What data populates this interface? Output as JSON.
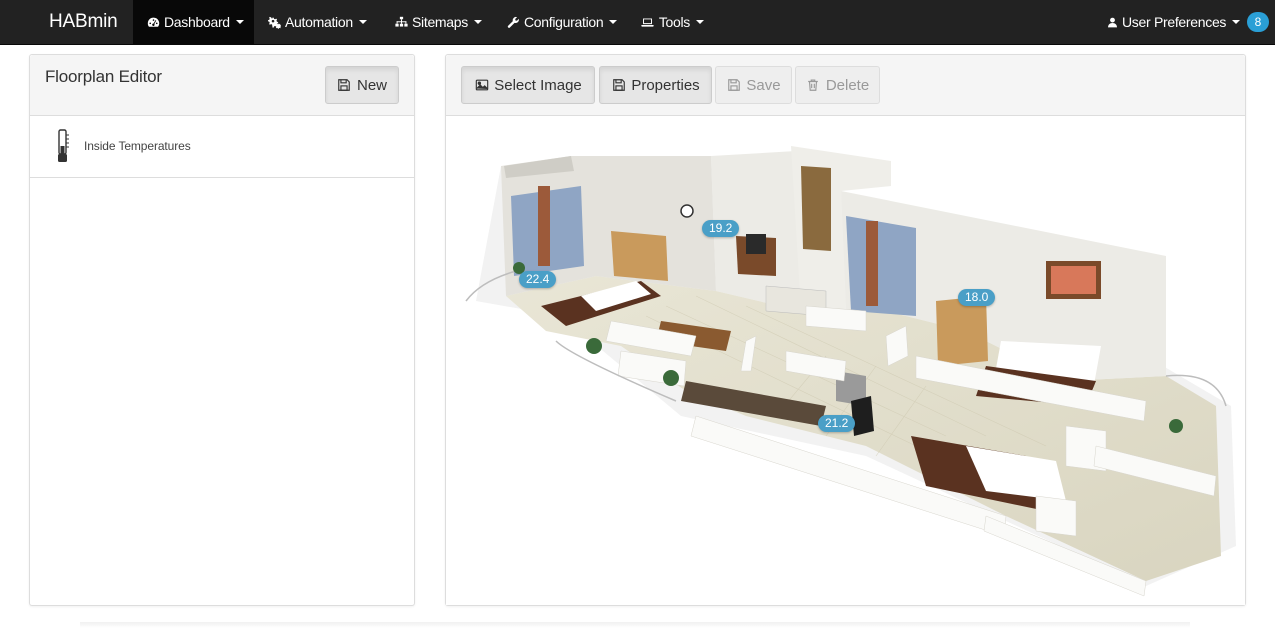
{
  "navbar": {
    "brand": "HABmin",
    "items": [
      {
        "label": "Dashboard",
        "icon": "dashboard-icon"
      },
      {
        "label": "Automation",
        "icon": "cogs-icon"
      },
      {
        "label": "Sitemaps",
        "icon": "sitemap-icon"
      },
      {
        "label": "Configuration",
        "icon": "wrench-icon"
      },
      {
        "label": "Tools",
        "icon": "laptop-icon"
      }
    ],
    "user_preferences": "User Preferences",
    "notification_count": "8"
  },
  "left_panel": {
    "title": "Floorplan Editor",
    "new_button": "New",
    "items": [
      {
        "label": "Inside Temperatures",
        "icon": "thermometer-icon"
      }
    ]
  },
  "toolbar": {
    "select_image": "Select Image",
    "properties": "Properties",
    "save": "Save",
    "delete": "Delete"
  },
  "floorplan": {
    "temperatures": [
      {
        "value": "19.2"
      },
      {
        "value": "22.4"
      },
      {
        "value": "18.0"
      },
      {
        "value": "21.2"
      }
    ]
  },
  "colors": {
    "navbar_bg": "#222222",
    "badge": "#2a9fd6",
    "temp_badge": "#4a9fc7"
  }
}
